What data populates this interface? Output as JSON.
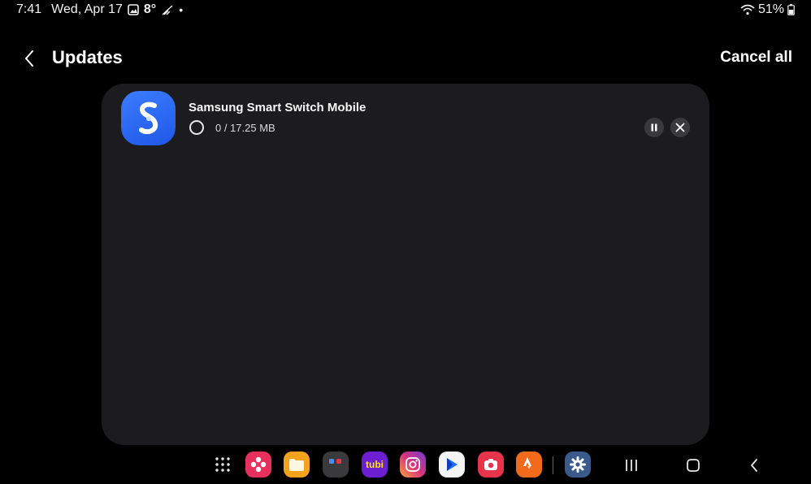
{
  "status_bar": {
    "time": "7:41",
    "date": "Wed, Apr 17",
    "temperature": "8°",
    "dot": "•",
    "battery_percent": "51%",
    "icons": [
      "gallery-icon",
      "weather-icon",
      "wifi-icon",
      "battery-icon"
    ]
  },
  "header": {
    "title": "Updates",
    "cancel_all_label": "Cancel all"
  },
  "updates": [
    {
      "app_name": "Samsung Smart Switch Mobile",
      "progress_text": "0 / 17.25 MB",
      "progress_fraction": 0,
      "icon": "smart-switch-icon",
      "icon_color": "#2b66f0"
    }
  ],
  "taskbar": {
    "apps": [
      {
        "name": "app-drawer",
        "icon": "grid-icon"
      },
      {
        "name": "blossom-app",
        "icon": "flower-icon",
        "color": "#e8305f"
      },
      {
        "name": "my-files",
        "icon": "folder-icon",
        "color": "#f3a21b"
      },
      {
        "name": "app-folder",
        "icon": "folder-group-icon",
        "color": "#3a3a3c"
      },
      {
        "name": "tubi",
        "icon": "tubi-icon",
        "label": "tubi",
        "color": "#6b1fd1"
      },
      {
        "name": "instagram",
        "icon": "instagram-icon",
        "color": "#d8327d"
      },
      {
        "name": "play-app",
        "icon": "play-icon",
        "color": "#f4f4f4"
      },
      {
        "name": "camera-app",
        "icon": "camera-icon",
        "color": "#e8344a"
      },
      {
        "name": "strava",
        "icon": "strava-icon",
        "color": "#f26a1b"
      },
      {
        "name": "settings",
        "icon": "gear-icon",
        "color": "#3b5a8c"
      }
    ],
    "nav": [
      "recents-icon",
      "home-icon",
      "back-icon"
    ]
  }
}
